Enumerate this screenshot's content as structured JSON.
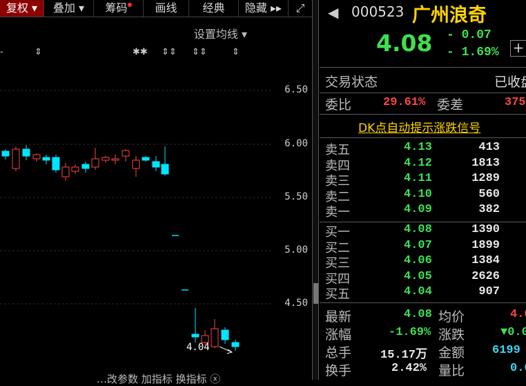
{
  "toolbar": {
    "items": [
      {
        "label": "复权 ▾"
      },
      {
        "label": "叠加 ▾"
      },
      {
        "label": "筹码"
      },
      {
        "label": "画线"
      },
      {
        "label": "经典"
      },
      {
        "label": "隐藏 ▸▸"
      }
    ],
    "expand_icon": "⤢"
  },
  "chart": {
    "ma_setting": "设置均线 ▾",
    "y_ticks": [
      "6.50",
      "6.00",
      "5.50",
      "5.00",
      "4.50"
    ],
    "low_label": "4.04",
    "bottom_labels": "…改参数  加指标  换指标  ⓧ"
  },
  "quote": {
    "code": "000523",
    "name": "广州浪奇",
    "price": "4.08",
    "change": "- 0.07",
    "change_pct": "- 1.69%",
    "add_icon": "+"
  },
  "status": {
    "label": "交易状态",
    "value": "已收盘"
  },
  "weibi": {
    "label": "委比",
    "value": "29.61%",
    "diff_label": "委差",
    "diff_value": "375"
  },
  "dk_link": "DK点自动提示涨跌信号",
  "sell": [
    {
      "label": "卖五",
      "price": "4.13",
      "vol": "413"
    },
    {
      "label": "卖四",
      "price": "4.12",
      "vol": "1813"
    },
    {
      "label": "卖三",
      "price": "4.11",
      "vol": "1289"
    },
    {
      "label": "卖二",
      "price": "4.10",
      "vol": "560"
    },
    {
      "label": "卖一",
      "price": "4.09",
      "vol": "382"
    }
  ],
  "buy": [
    {
      "label": "买一",
      "price": "4.08",
      "vol": "1390"
    },
    {
      "label": "买二",
      "price": "4.07",
      "vol": "1899"
    },
    {
      "label": "买三",
      "price": "4.06",
      "vol": "1384"
    },
    {
      "label": "买四",
      "price": "4.05",
      "vol": "2626"
    },
    {
      "label": "买五",
      "price": "4.04",
      "vol": "907"
    }
  ],
  "stats": {
    "latest_label": "最新",
    "latest": "4.08",
    "avg_label": "均价",
    "avg": "4.0",
    "pct_label": "涨幅",
    "pct": "-1.69%",
    "chg_label": "涨跌",
    "chg": "▼0.0",
    "vol_label": "总手",
    "vol": "15.17万",
    "amt_label": "金额",
    "amt": "6199",
    "turn_label": "换手",
    "turn": "2.42%",
    "ratio_label": "量比",
    "ratio": "0.6"
  },
  "colors": {
    "up": "#ff4545",
    "down": "#3cd6f0",
    "green": "#3ee050"
  }
}
